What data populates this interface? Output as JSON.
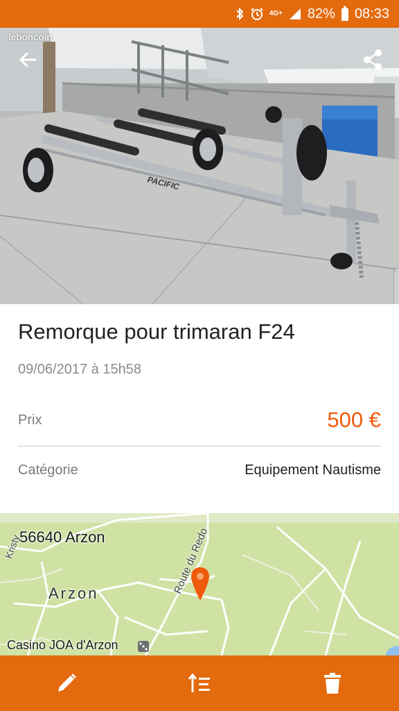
{
  "status_bar": {
    "network": "4G+",
    "battery": "82%",
    "time": "08:33"
  },
  "header": {
    "brand": "leboncoin",
    "back_icon": "arrow-left-icon",
    "share_icon": "share-icon"
  },
  "listing": {
    "title": "Remorque pour trimaran F24",
    "date": "09/06/2017 à 15h58",
    "price_label": "Prix",
    "price_value": "500 €",
    "category_label": "Catégorie",
    "category_value": "Equipement Nautisme"
  },
  "map": {
    "postal_label": "56640 Arzon",
    "town_label": "Arzon",
    "poi_label": "Casino JOA d'Arzon",
    "road_label_1": "Route du Redo",
    "road_label_2": "Kristy",
    "pin_icon": "map-pin-icon"
  },
  "bottom_bar": {
    "actions": [
      "edit-icon",
      "sort-icon",
      "delete-icon"
    ]
  },
  "colors": {
    "accent": "#e36a0d",
    "price": "#f05a0c",
    "map_bg": "#cfe2a4"
  }
}
